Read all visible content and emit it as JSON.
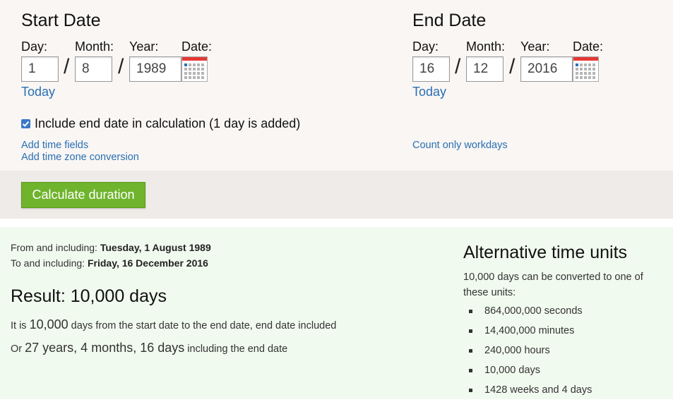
{
  "start": {
    "title": "Start Date",
    "labels": {
      "day": "Day:",
      "month": "Month:",
      "year": "Year:",
      "date": "Date:"
    },
    "day": "1",
    "month": "8",
    "year": "1989",
    "separator": "/",
    "today_link": "Today"
  },
  "end": {
    "title": "End Date",
    "labels": {
      "day": "Day:",
      "month": "Month:",
      "year": "Year:",
      "date": "Date:"
    },
    "day": "16",
    "month": "12",
    "year": "2016",
    "separator": "/",
    "today_link": "Today"
  },
  "options": {
    "include_end_label": "Include end date in calculation (1 day is added)",
    "include_end_checked": true,
    "add_time_fields": "Add time fields",
    "add_time_zone": "Add time zone conversion",
    "count_workdays": "Count only workdays"
  },
  "calculate_button": "Calculate duration",
  "result": {
    "from_prefix": "From and including: ",
    "from_value": "Tuesday, 1 August 1989",
    "to_prefix": "To and including: ",
    "to_value": "Friday, 16 December 2016",
    "heading": "Result: 10,000 days",
    "sentence1_prefix": "It is ",
    "sentence1_number": "10,000",
    "sentence1_suffix": " days from the start date to the end date, end date included",
    "sentence2_prefix": "Or ",
    "sentence2_value": "27 years, 4 months, 16 days",
    "sentence2_suffix": " including the end date"
  },
  "alternative": {
    "title": "Alternative time units",
    "intro": "10,000 days can be converted to one of these units:",
    "items": [
      "864,000,000 seconds",
      "14,400,000 minutes",
      "240,000 hours",
      "10,000 days",
      "1428 weeks and 4 days"
    ]
  },
  "colors": {
    "link": "#2a6fb3",
    "button_green": "#6fb42c",
    "results_background": "#f1faef",
    "form_background": "#f9f6f4",
    "calendar_red": "#e53935",
    "calendar_blue": "#2a6fb3"
  },
  "icons": {
    "calendar": "calendar-icon",
    "checkbox": "check-icon"
  }
}
